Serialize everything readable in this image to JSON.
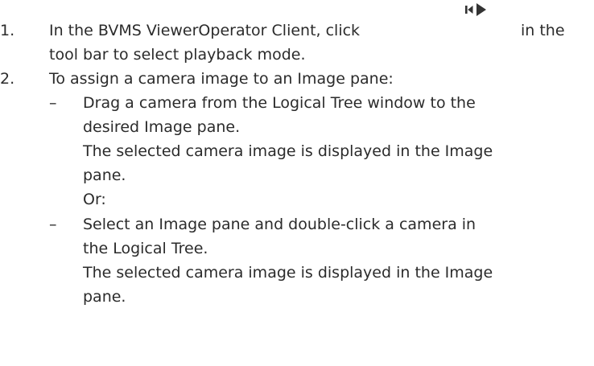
{
  "steps": [
    {
      "number": "1.",
      "line1_before_icon": "In the BVMS ViewerOperator Client, click",
      "line1_after_icon": "in the",
      "line2": "tool bar to select playback mode."
    },
    {
      "number": "2.",
      "text": "To assign a camera image to an Image pane:",
      "options": [
        {
          "bullet": "–",
          "line1": "Drag a camera from the Logical Tree window to the",
          "line2": "desired Image pane.",
          "result_line1": "The selected camera image is displayed in the Image",
          "result_line2": "pane.",
          "or_text": "Or:"
        },
        {
          "bullet": "–",
          "line1": "Select an Image pane and double-click a camera in",
          "line2": "the Logical Tree.",
          "result_line1": "The selected camera image is displayed in the Image",
          "result_line2": "pane."
        }
      ]
    }
  ],
  "icons": {
    "playback_mode": "playback-mode-icon"
  },
  "colors": {
    "text": "#2b2b2b",
    "icon": "#333333"
  }
}
